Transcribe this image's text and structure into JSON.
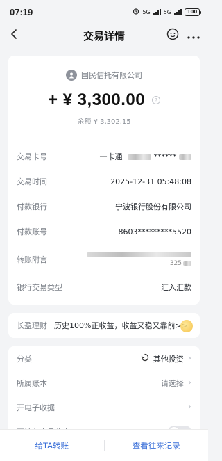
{
  "status_bar": {
    "time": "07:19",
    "battery": "100",
    "net_labels": [
      "5G",
      "5G"
    ]
  },
  "header": {
    "title": "交易详情"
  },
  "summary": {
    "payee": "国民信托有限公司",
    "amount": "+ ¥ 3,300.00",
    "balance": "余额 ¥ 3,302.15"
  },
  "details": [
    {
      "label": "交易卡号",
      "value": "一卡通"
    },
    {
      "label": "交易时间",
      "value": "2025-12-31 05:48:08"
    },
    {
      "label": "付款银行",
      "value": "宁波银行股份有限公司"
    },
    {
      "label": "付款账号",
      "value": "8603*********5520"
    },
    {
      "label": "转账附言",
      "value": ""
    },
    {
      "label": "银行交易类型",
      "value": "汇入汇款"
    }
  ],
  "card_masked": "******",
  "memo_partial": "325",
  "promo": {
    "label": "长盈理财",
    "text": "历史100%正收益，收益又稳又靠前>>"
  },
  "settings": {
    "category": {
      "label": "分类",
      "value": "其他投资"
    },
    "account": {
      "label": "所属账本",
      "value": "请选择"
    },
    "receipt": {
      "label": "开电子收据"
    },
    "exclude": {
      "label": "不计入本月收支"
    }
  },
  "bottom": {
    "transfer": "给TA转账",
    "history": "查看往来记录"
  }
}
